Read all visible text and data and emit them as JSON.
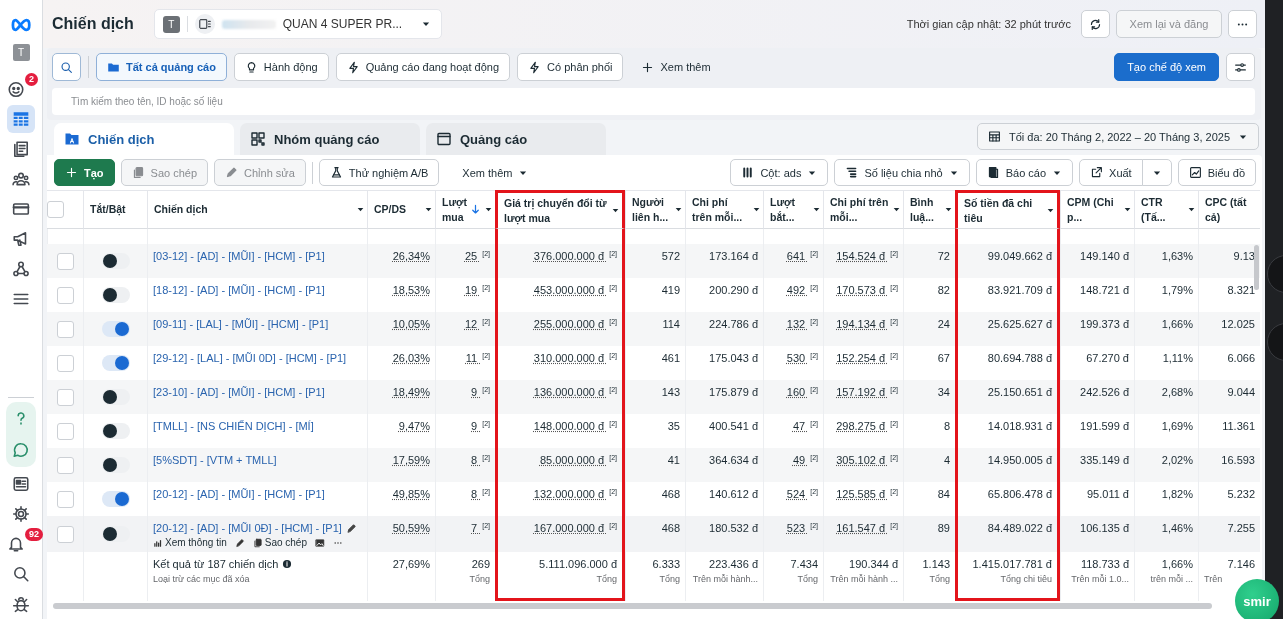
{
  "rail": {
    "top_items": [
      {
        "kind": "logo"
      },
      {
        "kind": "avatar",
        "label": "T"
      },
      {
        "kind": "face",
        "badge": "2",
        "selected": false
      },
      {
        "kind": "table",
        "selected": true
      },
      {
        "kind": "pages",
        "selected": false
      },
      {
        "kind": "people",
        "selected": false
      },
      {
        "kind": "card",
        "selected": false
      },
      {
        "kind": "megaphone",
        "selected": false
      },
      {
        "kind": "network",
        "selected": false
      },
      {
        "kind": "menu",
        "selected": false
      }
    ],
    "support_items": [
      {
        "kind": "help",
        "selected": false
      },
      {
        "kind": "chat",
        "selected": false
      }
    ],
    "bottom_items": [
      {
        "kind": "news",
        "selected": false
      },
      {
        "kind": "gear",
        "selected": false
      },
      {
        "kind": "bell",
        "badge": "92",
        "selected": false
      },
      {
        "kind": "search",
        "selected": false
      },
      {
        "kind": "bug",
        "selected": false
      }
    ]
  },
  "header": {
    "title": "Chiến dịch",
    "account": {
      "avatar": "T",
      "name": "QUAN 4 SUPER PR..."
    },
    "updated": "Thời gian cập nhật: 32 phút trước",
    "review_button": {
      "label": "Xem lại và đăng",
      "disabled": true
    }
  },
  "filters": {
    "items": [
      {
        "kind": "folder",
        "label": "Tất cả quảng cáo",
        "selected": true
      },
      {
        "kind": "bulb",
        "label": "Hành động",
        "selected": false
      },
      {
        "kind": "bolt",
        "label": "Quảng cáo đang hoạt động",
        "selected": false
      },
      {
        "kind": "bolt",
        "label": "Có phân phối",
        "selected": false
      },
      {
        "kind": "more",
        "label": "Xem thêm",
        "selected": false
      }
    ],
    "create_view": "Tạo chế độ xem",
    "search_placeholder": "Tìm kiếm theo tên, ID hoặc số liệu"
  },
  "tabs": [
    {
      "kind": "campaign",
      "label": "Chiến dịch",
      "selected": true
    },
    {
      "kind": "adset",
      "label": "Nhóm quảng cáo",
      "selected": false
    },
    {
      "kind": "ad",
      "label": "Quảng cáo",
      "selected": false
    }
  ],
  "date_range": "Tối đa: 20 Tháng 2, 2022 – 20 Tháng 3, 2025",
  "toolbar": {
    "left": [
      {
        "kind": "create",
        "label": "Tạo",
        "disabled": false
      },
      {
        "kind": "copy",
        "label": "Sao chép",
        "disabled": true
      },
      {
        "kind": "edit",
        "label": "Chỉnh sửa",
        "disabled": true
      },
      {
        "kind": "abtest",
        "label": "Thử nghiệm A/B",
        "disabled": false
      },
      {
        "kind": "more",
        "label": "Xem thêm",
        "disabled": false
      }
    ],
    "right": [
      {
        "kind": "columns",
        "label": "Cột: ads"
      },
      {
        "kind": "breakdown",
        "label": "Số liệu chia nhỏ"
      },
      {
        "kind": "reports",
        "label": "Báo cáo"
      },
      {
        "kind": "export",
        "label": "Xuất"
      },
      {
        "kind": "chart",
        "label": "Biểu đồ"
      }
    ]
  },
  "table": {
    "select_all": {
      "checked": false
    },
    "toggle_header": "Tắt/Bật",
    "name_header": "Chiến dịch",
    "columns": [
      {
        "label": "CP/DS",
        "menu": true,
        "sorted": false,
        "highlighted": false,
        "underlined": true
      },
      {
        "label": "Lượt mua",
        "menu": true,
        "sorted": true,
        "highlighted": false,
        "underlined": true
      },
      {
        "label": "Giá trị chuyển đổi từ lượt mua",
        "menu": true,
        "sorted": false,
        "highlighted": true,
        "underlined": true
      },
      {
        "label": "Người liên h...",
        "menu": true,
        "sorted": false,
        "highlighted": false,
        "underlined": false
      },
      {
        "label": "Chi phí trên mỗi...",
        "menu": true,
        "sorted": false,
        "highlighted": false,
        "underlined": false
      },
      {
        "label": "Lượt bắt...",
        "menu": true,
        "sorted": false,
        "highlighted": false,
        "underlined": true
      },
      {
        "label": "Chi phí trên mỗi...",
        "menu": true,
        "sorted": false,
        "highlighted": false,
        "underlined": true
      },
      {
        "label": "Bình luậ...",
        "menu": true,
        "sorted": false,
        "highlighted": false,
        "underlined": false
      },
      {
        "label": "Số tiền đã chi tiêu",
        "menu": true,
        "sorted": false,
        "highlighted": true,
        "underlined": false
      },
      {
        "label": "CPM (Chi p...",
        "menu": true,
        "sorted": false,
        "highlighted": false,
        "underlined": false
      },
      {
        "label": "CTR (Tấ...",
        "menu": true,
        "sorted": false,
        "highlighted": false,
        "underlined": false
      },
      {
        "label": "CPC (tất cả)",
        "menu": false,
        "sorted": false,
        "highlighted": false,
        "underlined": false
      }
    ],
    "rows": [
      {
        "checked": false,
        "on": false,
        "name": "[03-12] - [AD] - [MŨI] - [HCM] - [P1]",
        "cells": [
          "26,34%",
          "25 $^{[2]}$",
          "376.000.000 đ $^{[2]}$",
          "572",
          "173.164 đ",
          "641 $^{[2]}$",
          "154.524 đ $^{[2]}$",
          "72",
          "99.049.662 đ",
          "149.140 đ",
          "1,63%",
          "9.13"
        ]
      },
      {
        "checked": false,
        "on": false,
        "name": "[18-12] - [AD] - [MŨI] - [HCM] - [P1]",
        "cells": [
          "18,53%",
          "19 $^{[2]}$",
          "453.000.000 đ $^{[2]}$",
          "419",
          "200.290 đ",
          "492 $^{[2]}$",
          "170.573 đ $^{[2]}$",
          "82",
          "83.921.709 đ",
          "148.721 đ",
          "1,79%",
          "8.321"
        ]
      },
      {
        "checked": false,
        "on": true,
        "name": "[09-11] - [LAL] - [MŨI] - [HCM] - [P1]",
        "cells": [
          "10,05%",
          "12 $^{[2]}$",
          "255.000.000 đ $^{[2]}$",
          "114",
          "224.786 đ",
          "132 $^{[2]}$",
          "194.134 đ $^{[2]}$",
          "24",
          "25.625.627 đ",
          "199.373 đ",
          "1,66%",
          "12.025"
        ]
      },
      {
        "checked": false,
        "on": true,
        "name": "[29-12] - [LAL] - [MŨI 0D] - [HCM] - [P1]",
        "cells": [
          "26,03%",
          "11 $^{[2]}$",
          "310.000.000 đ $^{[2]}$",
          "461",
          "175.043 đ",
          "530 $^{[2]}$",
          "152.254 đ $^{[2]}$",
          "67",
          "80.694.788 đ",
          "67.270 đ",
          "1,11%",
          "6.066"
        ]
      },
      {
        "checked": false,
        "on": false,
        "name": "[23-10] - [AD] - [MŨI] - [HCM] - [P1]",
        "cells": [
          "18,49%",
          "9 $^{[2]}$",
          "136.000.000 đ $^{[2]}$",
          "143",
          "175.879 đ",
          "160 $^{[2]}$",
          "157.192 đ $^{[2]}$",
          "34",
          "25.150.651 đ",
          "242.526 đ",
          "2,68%",
          "9.044"
        ]
      },
      {
        "checked": false,
        "on": false,
        "name": "[TMLL] - [NS CHIẾN DỊCH] - [MÍ]",
        "cells": [
          "9,47%",
          "9 $^{[2]}$",
          "148.000.000 đ $^{[2]}$",
          "35",
          "400.541 đ",
          "47 $^{[2]}$",
          "298.275 đ $^{[2]}$",
          "8",
          "14.018.931 đ",
          "191.599 đ",
          "1,69%",
          "11.361"
        ]
      },
      {
        "checked": false,
        "on": false,
        "name": "[5%SDT] - [VTM + TMLL]",
        "cells": [
          "17,59%",
          "8 $^{[2]}$",
          "85.000.000 đ $^{[2]}$",
          "41",
          "364.634 đ",
          "49 $^{[2]}$",
          "305.102 đ $^{[2]}$",
          "4",
          "14.950.005 đ",
          "335.149 đ",
          "2,02%",
          "16.593"
        ]
      },
      {
        "checked": false,
        "on": true,
        "name": "[20-12] - [AD] - [MŨI] - [HCM] - [P1]",
        "cells": [
          "49,85%",
          "8 $^{[2]}$",
          "132.000.000 đ $^{[2]}$",
          "468",
          "140.612 đ",
          "524 $^{[2]}$",
          "125.585 đ $^{[2]}$",
          "84",
          "65.806.478 đ",
          "95.011 đ",
          "1,82%",
          "5.232"
        ]
      },
      {
        "checked": false,
        "on": false,
        "name": "[20-12] - [AD] - [MŨI 0Đ] - [HCM] - [P1]",
        "cells": [
          "50,59%",
          "7 $^{[2]}$",
          "167.000.000 đ $^{[2]}$",
          "468",
          "180.532 đ",
          "523 $^{[2]}$",
          "161.547 đ $^{[2]}$",
          "89",
          "84.489.022 đ",
          "106.135 đ",
          "1,46%",
          "7.255"
        ],
        "actions": [
          {
            "kind": "stats",
            "label": "Xem thông tin"
          },
          {
            "kind": "edit"
          },
          {
            "kind": "copy",
            "label": "Sao chép"
          },
          {
            "kind": "image"
          },
          {
            "kind": "more"
          }
        ]
      }
    ],
    "footer": {
      "title": "Kết quả từ 187 chiến dịch",
      "note": "Loại trừ các mục đã xóa",
      "cells": [
        {
          "value": "27,69%"
        },
        {
          "value": "269",
          "sub": "Tổng"
        },
        {
          "value": "5.111.096.000 đ",
          "sub": "Tổng"
        },
        {
          "value": "6.333",
          "sub": "Tổng"
        },
        {
          "value": "223.436 đ",
          "sub": "Trên mỗi hành..."
        },
        {
          "value": "7.434",
          "sub": "Tổng"
        },
        {
          "value": "190.344 đ",
          "sub": "Trên mỗi hành ..."
        },
        {
          "value": "1.143",
          "sub": "Tổng"
        },
        {
          "value": "1.415.017.781 đ",
          "sub": "Tổng chi tiêu"
        },
        {
          "value": "118.733 đ",
          "sub": "Trên mỗi 1.0..."
        },
        {
          "value": "1,66%",
          "sub": "trên mỗi ..."
        },
        {
          "value": "7.146",
          "sub": "Trên"
        }
      ]
    }
  },
  "floating_badge": {
    "label": "smir"
  }
}
